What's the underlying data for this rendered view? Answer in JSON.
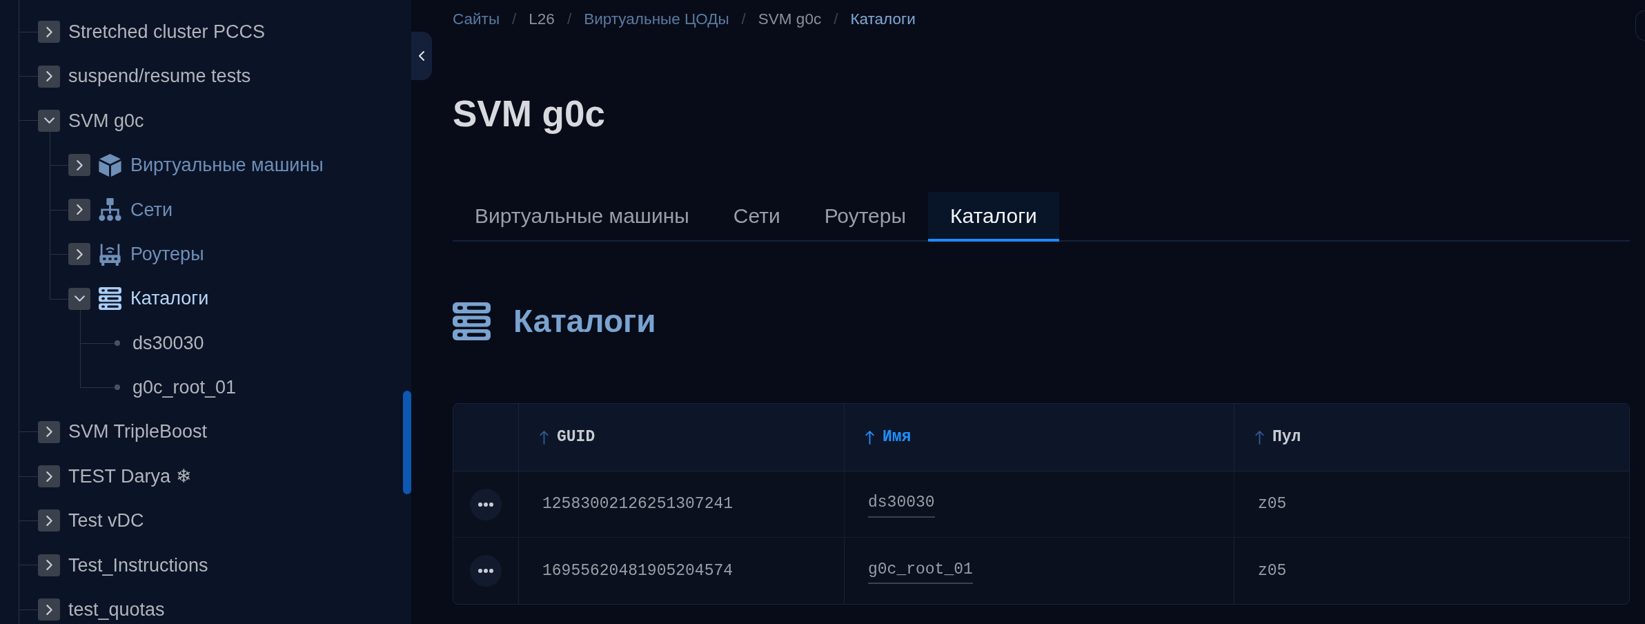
{
  "sidebar": {
    "tree": [
      {
        "label": "Stretched cluster PCCS",
        "expanded": false,
        "selected": false
      },
      {
        "label": "suspend/resume tests",
        "expanded": false,
        "selected": false
      },
      {
        "label": "SVM g0c",
        "expanded": true,
        "selected": false,
        "children": [
          {
            "label": "Виртуальные машины",
            "kind": "vms",
            "expanded": false,
            "selected": false
          },
          {
            "label": "Сети",
            "kind": "networks",
            "expanded": false,
            "selected": false
          },
          {
            "label": "Роутеры",
            "kind": "routers",
            "expanded": false,
            "selected": false
          },
          {
            "label": "Каталоги",
            "kind": "catalogs",
            "expanded": true,
            "selected": true,
            "children": [
              {
                "label": "ds30030",
                "selected": false
              },
              {
                "label": "g0c_root_01",
                "selected": false
              }
            ]
          }
        ]
      },
      {
        "label": "SVM TripleBoost",
        "expanded": false,
        "selected": false
      },
      {
        "label": "TEST Darya ❄",
        "expanded": false,
        "selected": false
      },
      {
        "label": "Test vDC",
        "expanded": false,
        "selected": false
      },
      {
        "label": "Test_Instructions",
        "expanded": false,
        "selected": false
      },
      {
        "label": "test_quotas",
        "expanded": false,
        "selected": false
      }
    ]
  },
  "breadcrumbs": [
    {
      "label": "Сайты",
      "kind": "link"
    },
    {
      "label": "/",
      "kind": "separator"
    },
    {
      "label": "L26",
      "kind": "plain"
    },
    {
      "label": "/",
      "kind": "separator"
    },
    {
      "label": "Виртуальные ЦОДы",
      "kind": "link"
    },
    {
      "label": "/",
      "kind": "separator"
    },
    {
      "label": "SVM g0c",
      "kind": "plain"
    },
    {
      "label": "/",
      "kind": "separator"
    },
    {
      "label": "Каталоги",
      "kind": "current"
    }
  ],
  "title": "SVM g0c",
  "tabs": [
    {
      "label": "Виртуальные машины",
      "selected": false
    },
    {
      "label": "Сети",
      "selected": false
    },
    {
      "label": "Роутеры",
      "selected": false
    },
    {
      "label": "Каталоги",
      "selected": true
    }
  ],
  "section": {
    "title": "Каталоги"
  },
  "table": {
    "columns": [
      {
        "label": "GUID",
        "selected": false
      },
      {
        "label": "Имя",
        "selected": true
      },
      {
        "label": "Пул",
        "selected": false
      }
    ],
    "rows": [
      {
        "guid": "12583002126251307241",
        "name": "ds30030",
        "pool": "z05"
      },
      {
        "guid": "16955620481905204574",
        "name": "g0c_root_01",
        "pool": "z05"
      }
    ]
  }
}
